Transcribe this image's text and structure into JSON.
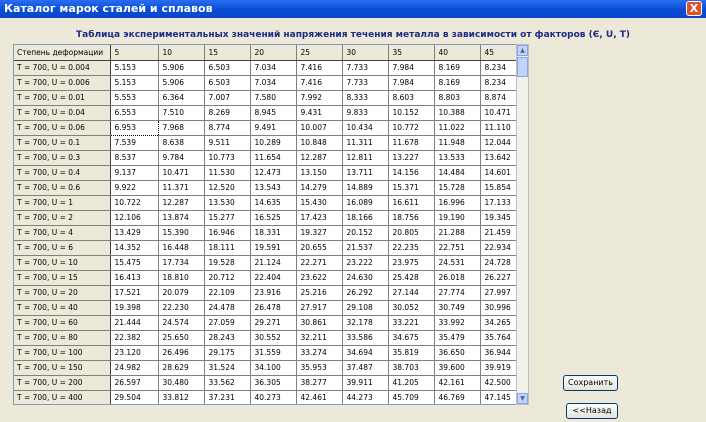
{
  "window": {
    "title": "Каталог марок сталей и сплавов",
    "close_label": "X"
  },
  "caption": "Таблица экспериментальных значений напряжения течения металла в зависимости от факторов (Є, U, T)",
  "table": {
    "corner": "Степень деформации",
    "columns": [
      "5",
      "10",
      "15",
      "20",
      "25",
      "30",
      "35",
      "40",
      "45"
    ],
    "rows": [
      {
        "label": "T = 700,  U = 0.004",
        "values": [
          "5.153",
          "5.906",
          "6.503",
          "7.034",
          "7.416",
          "7.733",
          "7.984",
          "8.169",
          "8.234"
        ]
      },
      {
        "label": "T = 700,  U = 0.006",
        "values": [
          "5.153",
          "5.906",
          "6.503",
          "7.034",
          "7.416",
          "7.733",
          "7.984",
          "8.169",
          "8.234"
        ]
      },
      {
        "label": "T = 700,  U = 0.01",
        "values": [
          "5.553",
          "6.364",
          "7.007",
          "7.580",
          "7.992",
          "8.333",
          "8.603",
          "8.803",
          "8.874"
        ]
      },
      {
        "label": "T = 700,  U = 0.04",
        "values": [
          "6.553",
          "7.510",
          "8.269",
          "8.945",
          "9.431",
          "9.833",
          "10.152",
          "10.388",
          "10.471"
        ]
      },
      {
        "label": "T = 700,  U = 0.06",
        "values": [
          "6.953",
          "7.968",
          "8.774",
          "9.491",
          "10.007",
          "10.434",
          "10.772",
          "11.022",
          "11.110"
        ]
      },
      {
        "label": "T = 700,  U = 0.1",
        "values": [
          "7.539",
          "8.638",
          "9.511",
          "10.289",
          "10.848",
          "11.311",
          "11.678",
          "11.948",
          "12.044"
        ]
      },
      {
        "label": "T = 700,  U = 0.3",
        "values": [
          "8.537",
          "9.784",
          "10.773",
          "11.654",
          "12.287",
          "12.811",
          "13.227",
          "13.533",
          "13.642"
        ]
      },
      {
        "label": "T = 700,  U = 0.4",
        "values": [
          "9.137",
          "10.471",
          "11.530",
          "12.473",
          "13.150",
          "13.711",
          "14.156",
          "14.484",
          "14.601"
        ]
      },
      {
        "label": "T = 700,  U = 0.6",
        "values": [
          "9.922",
          "11.371",
          "12.520",
          "13.543",
          "14.279",
          "14.889",
          "15.371",
          "15.728",
          "15.854"
        ]
      },
      {
        "label": "T = 700,  U = 1",
        "values": [
          "10.722",
          "12.287",
          "13.530",
          "14.635",
          "15.430",
          "16.089",
          "16.611",
          "16.996",
          "17.133"
        ]
      },
      {
        "label": "T = 700,  U = 2",
        "values": [
          "12.106",
          "13.874",
          "15.277",
          "16.525",
          "17.423",
          "18.166",
          "18.756",
          "19.190",
          "19.345"
        ]
      },
      {
        "label": "T = 700,  U = 4",
        "values": [
          "13.429",
          "15.390",
          "16.946",
          "18.331",
          "19.327",
          "20.152",
          "20.805",
          "21.288",
          "21.459"
        ]
      },
      {
        "label": "T = 700,  U = 6",
        "values": [
          "14.352",
          "16.448",
          "18.111",
          "19.591",
          "20.655",
          "21.537",
          "22.235",
          "22.751",
          "22.934"
        ]
      },
      {
        "label": "T = 700,  U = 10",
        "values": [
          "15.475",
          "17.734",
          "19.528",
          "21.124",
          "22.271",
          "23.222",
          "23.975",
          "24.531",
          "24.728"
        ]
      },
      {
        "label": "T = 700,  U = 15",
        "values": [
          "16.413",
          "18.810",
          "20.712",
          "22.404",
          "23.622",
          "24.630",
          "25.428",
          "26.018",
          "26.227"
        ]
      },
      {
        "label": "T = 700,  U = 20",
        "values": [
          "17.521",
          "20.079",
          "22.109",
          "23.916",
          "25.216",
          "26.292",
          "27.144",
          "27.774",
          "27.997"
        ]
      },
      {
        "label": "T = 700,  U = 40",
        "values": [
          "19.398",
          "22.230",
          "24.478",
          "26.478",
          "27.917",
          "29.108",
          "30.052",
          "30.749",
          "30.996"
        ]
      },
      {
        "label": "T = 700,  U = 60",
        "values": [
          "21.444",
          "24.574",
          "27.059",
          "29.271",
          "30.861",
          "32.178",
          "33.221",
          "33.992",
          "34.265"
        ]
      },
      {
        "label": "T = 700,  U = 80",
        "values": [
          "22.382",
          "25.650",
          "28.243",
          "30.552",
          "32.211",
          "33.586",
          "34.675",
          "35.479",
          "35.764"
        ]
      },
      {
        "label": "T = 700,  U = 100",
        "values": [
          "23.120",
          "26.496",
          "29.175",
          "31.559",
          "33.274",
          "34.694",
          "35.819",
          "36.650",
          "36.944"
        ]
      },
      {
        "label": "T = 700,  U = 150",
        "values": [
          "24.982",
          "28.629",
          "31.524",
          "34.100",
          "35.953",
          "37.487",
          "38.703",
          "39.600",
          "39.919"
        ]
      },
      {
        "label": "T = 700,  U = 200",
        "values": [
          "26.597",
          "30.480",
          "33.562",
          "36.305",
          "38.277",
          "39.911",
          "41.205",
          "42.161",
          "42.500"
        ]
      },
      {
        "label": "T = 700,  U = 400",
        "values": [
          "29.504",
          "33.812",
          "37.231",
          "40.273",
          "42.461",
          "44.273",
          "45.709",
          "46.769",
          "47.145"
        ]
      }
    ]
  },
  "buttons": {
    "save": "Сохранить",
    "back": "<<Назад"
  },
  "scroll": {
    "up": "▲",
    "down": "▼"
  }
}
